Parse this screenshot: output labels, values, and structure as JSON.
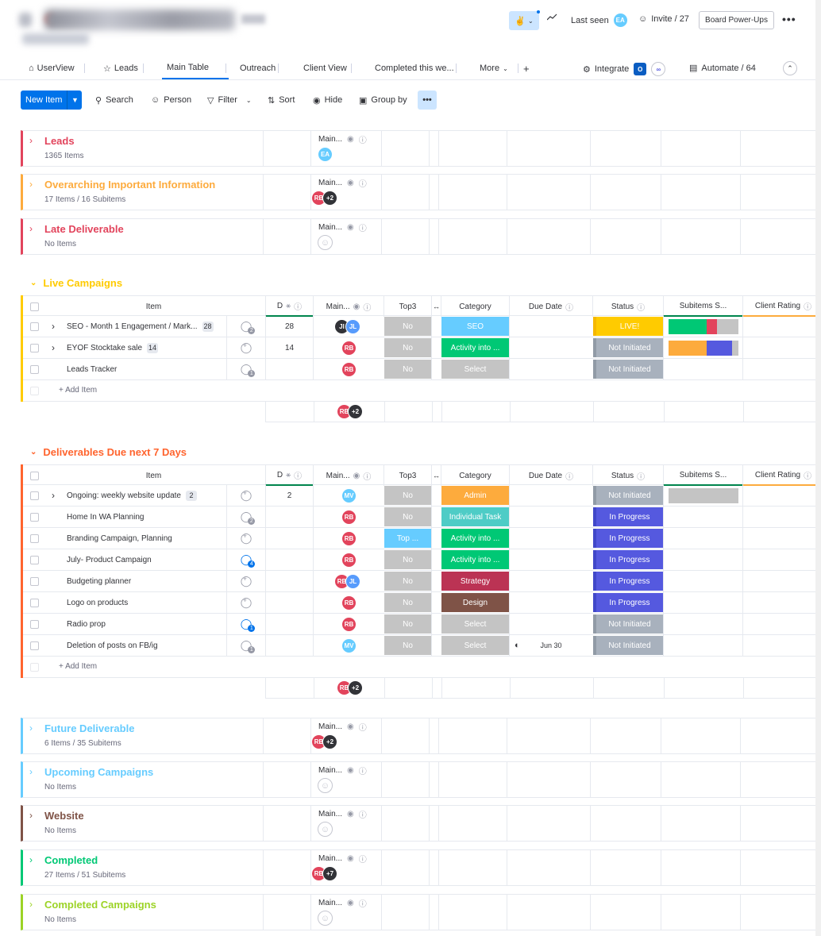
{
  "header": {
    "last_seen_label": "Last seen",
    "last_seen_avatar": "EA",
    "invite_label": "Invite / 27",
    "powerups_label": "Board Power-Ups"
  },
  "tabs": [
    {
      "label": "UserView",
      "icon": "home-icon"
    },
    {
      "label": "Leads",
      "icon": "star-icon"
    },
    {
      "label": "Main Table"
    },
    {
      "label": "Outreach"
    },
    {
      "label": "Client View"
    },
    {
      "label": "Completed this we..."
    },
    {
      "label": "More"
    }
  ],
  "integrate_label": "Integrate",
  "automate_label": "Automate / 64",
  "toolbar": {
    "new_item": "New Item",
    "search": "Search",
    "person": "Person",
    "filter": "Filter",
    "sort": "Sort",
    "hide": "Hide",
    "group_by": "Group by"
  },
  "columns": {
    "item": "Item",
    "d": "D",
    "main": "Main...",
    "top3": "Top3",
    "category": "Category",
    "due": "Due Date",
    "status": "Status",
    "subitems": "Subitems S...",
    "rating": "Client Rating"
  },
  "add_item": "+ Add Item",
  "collapsed_groups": [
    {
      "title": "Leads",
      "count": "1365 Items",
      "color": "#e2445c",
      "avatars": [
        "EA"
      ]
    },
    {
      "title": "Overarching Important Information",
      "count": "17 Items / 16 Subitems",
      "color": "#fdab3d",
      "avatars": [
        "RB",
        "+2"
      ]
    },
    {
      "title": "Late Deliverable",
      "count": "No Items",
      "color": "#e2445c",
      "avatars": []
    },
    {
      "title": "Future Deliverable",
      "count": "6 Items / 35 Subitems",
      "color": "#66ccff",
      "avatars": [
        "RB",
        "+2"
      ]
    },
    {
      "title": "Upcoming Campaigns",
      "count": "No Items",
      "color": "#66ccff",
      "avatars": []
    },
    {
      "title": "Website",
      "count": "No Items",
      "color": "#7f5347",
      "avatars": []
    },
    {
      "title": "Completed",
      "count": "27 Items / 51 Subitems",
      "color": "#00c875",
      "avatars": [
        "RB",
        "+7"
      ]
    },
    {
      "title": "Completed Campaigns",
      "count": "No Items",
      "color": "#9cd326",
      "avatars": []
    }
  ],
  "live": {
    "title": "Live Campaigns",
    "color": "#ffcb00",
    "rows": [
      {
        "name": "SEO - Month 1 Engagement / Mark...",
        "badge": "28",
        "d": "28",
        "avatars": [
          "JI",
          "JL"
        ],
        "top3": "No",
        "category": "SEO",
        "cat_color": "#66ccff",
        "status": "LIVE!",
        "status_color": "#ffcb00",
        "sub": [
          [
            "#00c875",
            0.55
          ],
          [
            "#e2445c",
            0.15
          ],
          [
            "#c4c4c4",
            0.3
          ]
        ],
        "expand": true,
        "conv": "2"
      },
      {
        "name": "EYOF Stocktake sale",
        "badge": "14",
        "d": "14",
        "avatars": [
          "RB"
        ],
        "top3": "No",
        "category": "Activity into ...",
        "cat_color": "#00c875",
        "status": "Not Initiated",
        "status_color": "#a8b1bd",
        "sub": [
          [
            "#fdab3d",
            0.55
          ],
          [
            "#5559df",
            0.37
          ],
          [
            "#c4c4c4",
            0.08
          ]
        ],
        "expand": true,
        "conv": ""
      },
      {
        "name": "Leads Tracker",
        "badge": "",
        "d": "",
        "avatars": [
          "RB"
        ],
        "top3": "No",
        "category": "Select",
        "cat_color": "#c4c4c4",
        "status": "Not Initiated",
        "status_color": "#a8b1bd",
        "sub": [],
        "expand": false,
        "conv": "1"
      }
    ],
    "footer_avatars": [
      "RB",
      "+2"
    ]
  },
  "due7": {
    "title": "Deliverables Due next 7 Days",
    "color": "#ff642e",
    "rows": [
      {
        "name": "Ongoing: weekly website update",
        "badge": "2",
        "d": "2",
        "avatars": [
          "MV"
        ],
        "top3": "No",
        "category": "Admin",
        "cat_color": "#fdab3d",
        "status": "Not Initiated",
        "status_color": "#a8b1bd",
        "sub": [
          [
            "#c4c4c4",
            1
          ]
        ],
        "expand": true,
        "conv": "",
        "due": ""
      },
      {
        "name": "Home In WA Planning",
        "badge": "",
        "d": "",
        "avatars": [
          "RB"
        ],
        "top3": "No",
        "category": "Individual Task",
        "cat_color": "#4eccc6",
        "status": "In Progress",
        "status_color": "#5559df",
        "sub": [],
        "expand": false,
        "conv": "2",
        "due": ""
      },
      {
        "name": "Branding Campaign, Planning",
        "badge": "",
        "d": "",
        "avatars": [
          "RB"
        ],
        "top3": "Top ...",
        "top3_color": "#66ccff",
        "category": "Activity into ...",
        "cat_color": "#00c875",
        "status": "In Progress",
        "status_color": "#5559df",
        "sub": [],
        "expand": false,
        "conv": "",
        "due": ""
      },
      {
        "name": "July- Product Campaign",
        "badge": "",
        "d": "",
        "avatars": [
          "RB"
        ],
        "top3": "No",
        "category": "Activity into ...",
        "cat_color": "#00c875",
        "status": "In Progress",
        "status_color": "#5559df",
        "sub": [],
        "expand": false,
        "conv": "4",
        "conv_blue": true,
        "due": ""
      },
      {
        "name": "Budgeting planner",
        "badge": "",
        "d": "",
        "avatars": [
          "RB",
          "JL"
        ],
        "top3": "No",
        "category": "Strategy",
        "cat_color": "#bb3354",
        "status": "In Progress",
        "status_color": "#5559df",
        "sub": [],
        "expand": false,
        "conv": "",
        "due": ""
      },
      {
        "name": "Logo on products",
        "badge": "",
        "d": "",
        "avatars": [
          "RB"
        ],
        "top3": "No",
        "category": "Design",
        "cat_color": "#7f5347",
        "status": "In Progress",
        "status_color": "#5559df",
        "sub": [],
        "expand": false,
        "conv": "",
        "due": ""
      },
      {
        "name": "Radio prop",
        "badge": "",
        "d": "",
        "avatars": [
          "RB"
        ],
        "top3": "No",
        "category": "Select",
        "cat_color": "#c4c4c4",
        "status": "Not Initiated",
        "status_color": "#a8b1bd",
        "sub": [],
        "expand": false,
        "conv": "1",
        "conv_blue": true,
        "due": ""
      },
      {
        "name": "Deletion of posts on FB/ig",
        "badge": "",
        "d": "",
        "avatars": [
          "MV"
        ],
        "top3": "No",
        "category": "Select",
        "cat_color": "#c4c4c4",
        "status": "Not Initiated",
        "status_color": "#a8b1bd",
        "sub": [],
        "expand": false,
        "conv": "1",
        "due": "Jun 30"
      }
    ],
    "footer_avatars": [
      "RB",
      "+2"
    ]
  }
}
